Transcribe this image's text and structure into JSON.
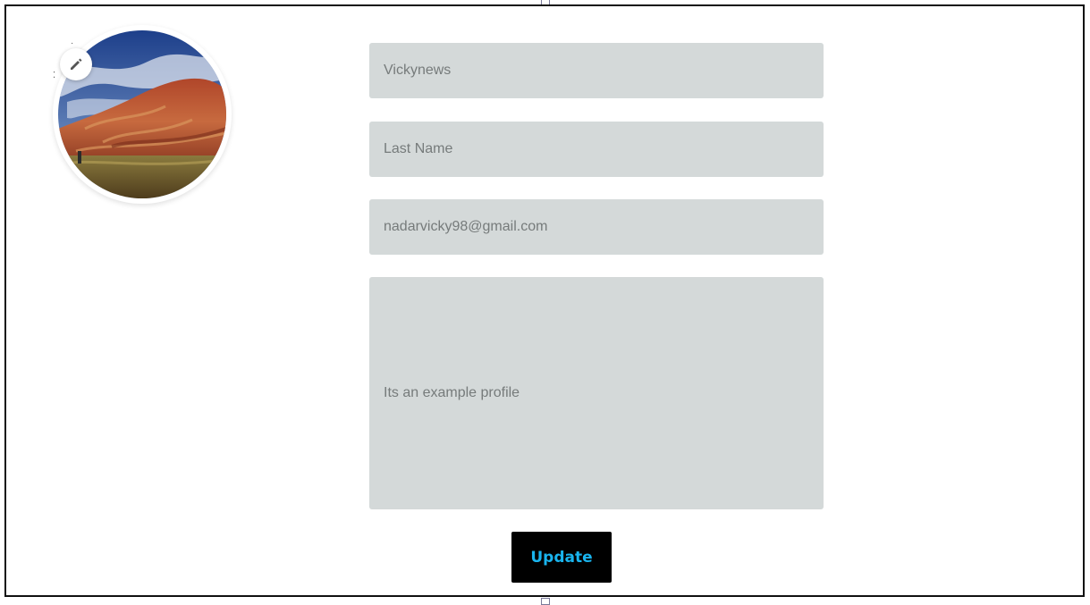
{
  "profile": {
    "avatar_alt": "profile picture",
    "edit_icon": "pencil-icon"
  },
  "form": {
    "first_name": "Vickynews",
    "last_name_placeholder": "Last Name",
    "email": "nadarvicky98@gmail.com",
    "bio": "Its an example profile"
  },
  "actions": {
    "update_label": "Update"
  },
  "colors": {
    "field_background": "#d4d9d9",
    "field_text": "#767b7b",
    "button_background": "#000000",
    "button_text": "#19b4ee"
  }
}
